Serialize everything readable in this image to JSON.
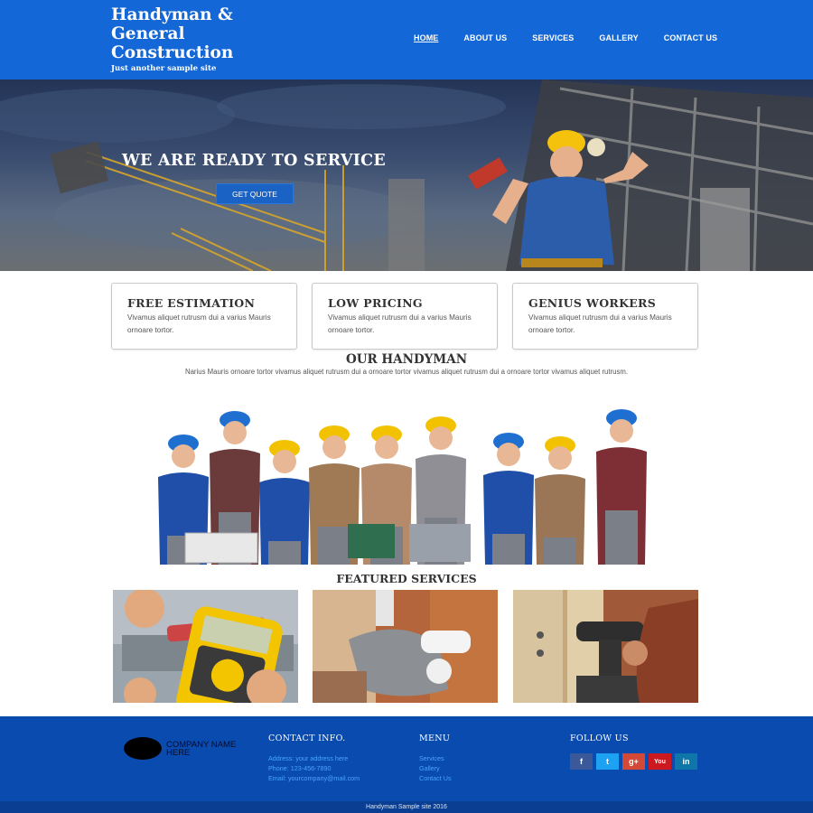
{
  "header": {
    "title": "Handyman & General Construction",
    "tagline": "Just another sample site",
    "nav": [
      "HOME",
      "ABOUT US",
      "SERVICES",
      "GALLERY",
      "CONTACT US"
    ]
  },
  "hero": {
    "title": "WE ARE READY TO SERVICE",
    "button": "GET QUOTE"
  },
  "features": [
    {
      "title": "FREE ESTIMATION",
      "text": "Vivamus aliquet rutrusm dui a varius Mauris ornoare tortor."
    },
    {
      "title": "LOW PRICING",
      "text": "Vivamus aliquet rutrusm dui a varius Mauris ornoare tortor."
    },
    {
      "title": "GENIUS WORKERS",
      "text": "Vivamus aliquet rutrusm dui a varius Mauris ornoare tortor."
    }
  ],
  "handyman": {
    "title": "OUR HANDYMAN",
    "text": "Narius Mauris ornoare tortor vivamus aliquet rutrusm dui a ornoare tortor vivamus aliquet rutrusm dui a ornoare tortor vivamus aliquet rutrusm."
  },
  "featured": {
    "title": "FEATURED SERVICES"
  },
  "footer": {
    "company": "COMPANY NAME HERE",
    "contact_title": "CONTACT INFO.",
    "address": "Address: your address here",
    "phone": "Phone: 123-456-7890",
    "email": "Email: yourcompany@mail.com",
    "menu_title": "MENU",
    "menu": [
      "Services",
      "Gallery",
      "Contact Us"
    ],
    "follow_title": "FOLLOW US",
    "social": [
      {
        "icon": "facebook-icon",
        "glyph": "f",
        "color": "#3b5998"
      },
      {
        "icon": "twitter-icon",
        "glyph": "t",
        "color": "#1da1f2"
      },
      {
        "icon": "google-plus-icon",
        "glyph": "g+",
        "color": "#d34836"
      },
      {
        "icon": "youtube-icon",
        "glyph": "You",
        "color": "#cc181e"
      },
      {
        "icon": "linkedin-icon",
        "glyph": "in",
        "color": "#0e76a8"
      }
    ],
    "copyright": "Handyman Sample site 2016"
  },
  "colors": {
    "header": "#1467d6",
    "footer": "#0a4bb0",
    "link": "#4aa3ff"
  }
}
